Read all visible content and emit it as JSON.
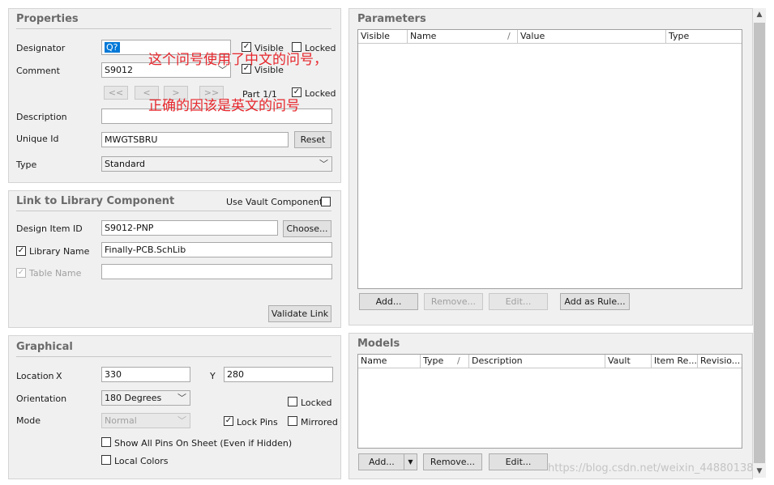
{
  "properties": {
    "title": "Properties",
    "designator_label": "Designator",
    "designator_value": "Q?",
    "visible_label": "Visible",
    "locked_label": "Locked",
    "comment_label": "Comment",
    "comment_value": "S9012",
    "comment_visible_label": "Visible",
    "nav_first": "<<",
    "nav_prev": "<",
    "nav_next": ">",
    "nav_last": ">>",
    "part_label": "Part 1/1",
    "part_locked_label": "Locked",
    "description_label": "Description",
    "description_value": "",
    "unique_id_label": "Unique Id",
    "unique_id_value": "MWGTSBRU",
    "reset_label": "Reset",
    "type_label": "Type",
    "type_value": "Standard"
  },
  "annotations": {
    "line1": "这个问号使用了中文的问号，",
    "line2": "正确的因该是英文的问号"
  },
  "link": {
    "title": "Link to Library Component",
    "use_vault_label": "Use Vault Component",
    "design_item_label": "Design Item ID",
    "design_item_value": "S9012-PNP",
    "choose_label": "Choose...",
    "library_name_label": "Library Name",
    "library_name_value": "Finally-PCB.SchLib",
    "table_name_label": "Table Name",
    "table_name_value": "",
    "validate_label": "Validate Link"
  },
  "graphical": {
    "title": "Graphical",
    "location_label": "Location",
    "x_label": "X",
    "x_value": "330",
    "y_label": "Y",
    "y_value": "280",
    "orientation_label": "Orientation",
    "orientation_value": "180 Degrees",
    "locked_label": "Locked",
    "mode_label": "Mode",
    "mode_value": "Normal",
    "lock_pins_label": "Lock Pins",
    "mirrored_label": "Mirrored",
    "show_all_pins_label": "Show All Pins On Sheet (Even if Hidden)",
    "local_colors_label": "Local Colors"
  },
  "parameters": {
    "title": "Parameters",
    "columns": [
      "Visible",
      "Name",
      "/",
      "Value",
      "Type"
    ],
    "add_label": "Add...",
    "remove_label": "Remove...",
    "edit_label": "Edit...",
    "add_rule_label": "Add as Rule..."
  },
  "models": {
    "title": "Models",
    "columns": [
      "Name",
      "Type",
      "/",
      "Description",
      "Vault",
      "Item Re...",
      "Revisio..."
    ],
    "add_label": "Add...",
    "remove_label": "Remove...",
    "edit_label": "Edit..."
  },
  "watermark": "https://blog.csdn.net/weixin_44880138"
}
